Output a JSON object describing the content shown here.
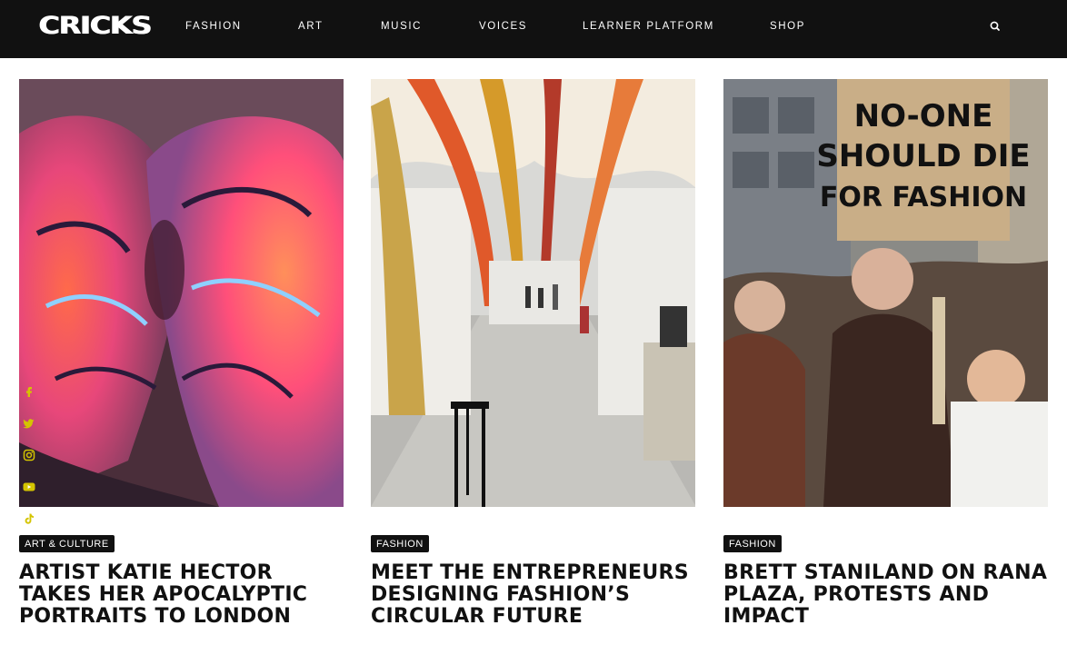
{
  "site": {
    "logo_text": "CRICKS"
  },
  "nav": {
    "items": [
      {
        "label": "FASHION"
      },
      {
        "label": "ART"
      },
      {
        "label": "MUSIC"
      },
      {
        "label": "VOICES"
      },
      {
        "label": "LEARNER PLATFORM"
      },
      {
        "label": "SHOP"
      }
    ],
    "search_icon": "search-icon"
  },
  "social": [
    "facebook-icon",
    "twitter-icon",
    "instagram-icon",
    "youtube-icon",
    "tiktok-icon"
  ],
  "articles": [
    {
      "category": "ART & CULTURE",
      "title": "ARTIST KATIE HECTOR TAKES HER APOCALYPTIC PORTRAITS TO LONDON"
    },
    {
      "category": "FASHION",
      "title": "MEET THE ENTREPRENEURS DESIGNING FASHION’S CIRCULAR FUTURE"
    },
    {
      "category": "FASHION",
      "title": "BRETT STANILAND ON RANA PLAZA, PROTESTS AND IMPACT",
      "image_sign_text": [
        "NO-ONE",
        "SHOULD DIE",
        "FOR FASHION"
      ]
    }
  ],
  "colors": {
    "bar": "#111111",
    "social_icon": "#d4c400",
    "tag_bg": "#111111"
  }
}
